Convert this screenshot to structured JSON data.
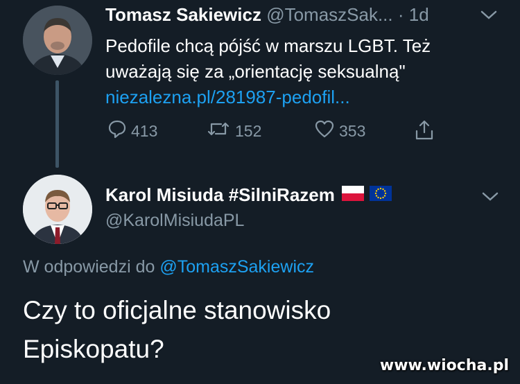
{
  "tweet1": {
    "author_name": "Tomasz Sakiewicz",
    "handle": "@TomaszSak...",
    "age": "· 1d",
    "text_line1": "Pedofile chcą pójść w marszu LGBT. Też",
    "text_line2": "uważają się za „orientację seksualną\"",
    "link": "niezalezna.pl/281987-pedofil...",
    "replies": "413",
    "retweets": "152",
    "likes": "353"
  },
  "tweet2": {
    "author_name": "Karol Misiuda #SilniRazem",
    "handle": "@KarolMisiudaPL",
    "reply_prefix": "W odpowiedzi do",
    "reply_to": "@TomaszSakiewicz",
    "text_line1": "Czy to oficjalne stanowisko",
    "text_line2": "Episkopatu?"
  },
  "icons": [
    "reply-icon",
    "retweet-icon",
    "like-icon",
    "share-icon",
    "chevron-down-icon",
    "poland-flag-icon",
    "eu-flag-icon"
  ],
  "colors": {
    "background": "#141d26",
    "muted": "#8899a6",
    "link": "#1da1f2"
  },
  "watermark": "www.wiocha.pl"
}
